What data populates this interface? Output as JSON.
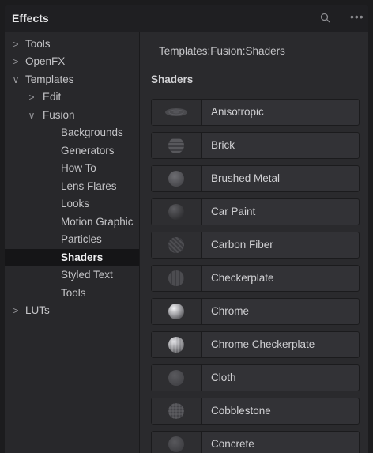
{
  "panel": {
    "title": "Effects",
    "header_icons": [
      "search-icon",
      "more-options-icon"
    ],
    "more_glyph": "•••"
  },
  "tree": {
    "items": [
      {
        "label": "Tools",
        "chevron": ">",
        "expanded": false
      },
      {
        "label": "OpenFX",
        "chevron": ">",
        "expanded": false
      },
      {
        "label": "Templates",
        "chevron": "∨",
        "expanded": true
      },
      {
        "label": "Edit",
        "chevron": ">",
        "expanded": false
      },
      {
        "label": "Fusion",
        "chevron": "∨",
        "expanded": true
      },
      {
        "label": "Backgrounds"
      },
      {
        "label": "Generators"
      },
      {
        "label": "How To"
      },
      {
        "label": "Lens Flares"
      },
      {
        "label": "Looks"
      },
      {
        "label": "Motion Graphic"
      },
      {
        "label": "Particles"
      },
      {
        "label": "Shaders",
        "selected": true
      },
      {
        "label": "Styled Text"
      },
      {
        "label": "Tools"
      },
      {
        "label": "LUTs",
        "chevron": ">",
        "expanded": false
      }
    ]
  },
  "content": {
    "path": "Templates:Fusion:Shaders",
    "section_title": "Shaders",
    "tiles": [
      {
        "name": "Anisotropic",
        "thumb": "anisotropic-thumbnail-icon"
      },
      {
        "name": "Brick",
        "thumb": "brick-thumbnail-icon"
      },
      {
        "name": "Brushed Metal",
        "thumb": "brushed-metal-thumbnail-icon"
      },
      {
        "name": "Car Paint",
        "thumb": "car-paint-thumbnail-icon"
      },
      {
        "name": "Carbon Fiber",
        "thumb": "carbon-fiber-thumbnail-icon"
      },
      {
        "name": "Checkerplate",
        "thumb": "checkerplate-thumbnail-icon"
      },
      {
        "name": "Chrome",
        "thumb": "chrome-thumbnail-icon"
      },
      {
        "name": "Chrome Checkerplate",
        "thumb": "chrome-checkerplate-thumbnail-icon"
      },
      {
        "name": "Cloth",
        "thumb": "cloth-thumbnail-icon"
      },
      {
        "name": "Cobblestone",
        "thumb": "cobblestone-thumbnail-icon"
      },
      {
        "name": "Concrete",
        "thumb": "concrete-thumbnail-icon"
      }
    ]
  },
  "colors": {
    "panel_bg": "#28282b",
    "header_bg": "#1f1f22",
    "selected_bg": "#151517",
    "tile_bg": "#323236"
  }
}
